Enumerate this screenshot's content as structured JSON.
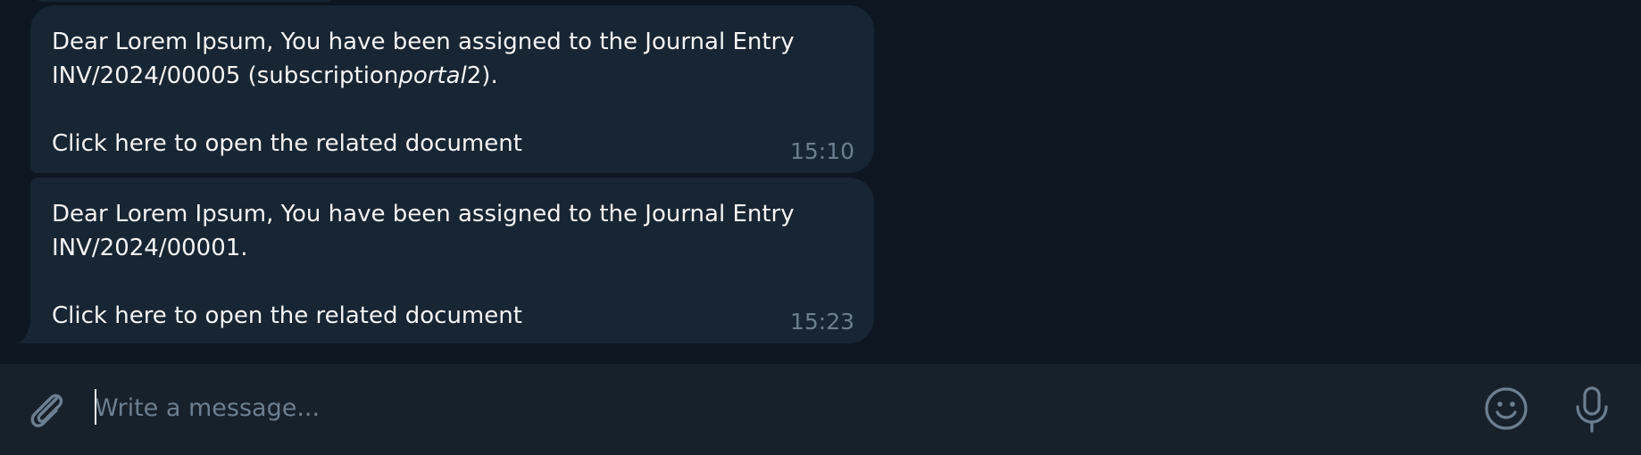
{
  "messages": [
    {
      "line1": "Dear Lorem Ipsum, You have been assigned to the Journal Entry",
      "line2_before": "INV/2024/00005 (subscription",
      "line2_italic": "portal",
      "line2_after": "2).",
      "link": "Click here to open the related document",
      "time": "15:10"
    },
    {
      "line1": "Dear Lorem Ipsum, You have been assigned to the Journal Entry",
      "line2": "INV/2024/00001.",
      "link": "Click here to open the related document",
      "time": "15:23"
    }
  ],
  "composer": {
    "placeholder": "Write a message..."
  },
  "icons": {
    "attach": "paperclip-icon",
    "emoji": "smiley-icon",
    "mic": "microphone-icon"
  },
  "colors": {
    "background": "#0e1621",
    "bubble": "#182533",
    "composer": "#17212b",
    "text": "#f5f5f5",
    "muted": "#6d7f8f"
  }
}
